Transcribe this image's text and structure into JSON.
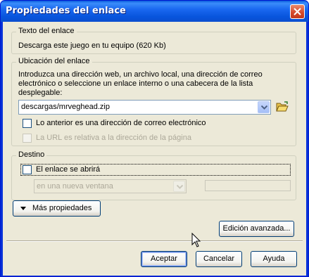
{
  "window": {
    "title": "Propiedades del enlace"
  },
  "link_text": {
    "group_label": "Texto del enlace",
    "value": "Descarga este juego en tu equipo (620 Kb)"
  },
  "location": {
    "group_label": "Ubicación del enlace",
    "instructions_line1": "Introduzca una dirección web, un archivo local, una dirección de correo",
    "instructions_line2": "electrónico o seleccione un enlace interno o una cabecera de la lista",
    "instructions_line3": "desplegable:",
    "url_value": "descargas/mrveghead.zip",
    "email_checkbox_label": "Lo anterior es una dirección de correo electrónico",
    "relative_checkbox_label": "La URL es relativa a la dirección de la página"
  },
  "target": {
    "group_label": "Destino",
    "checkbox_label": "El enlace se abrirá",
    "select_value": "en una nueva ventana"
  },
  "buttons": {
    "more_properties": "Más propiedades",
    "advanced_edit": "Edición avanzada...",
    "accept": "Aceptar",
    "cancel": "Cancelar",
    "help": "Ayuda"
  }
}
